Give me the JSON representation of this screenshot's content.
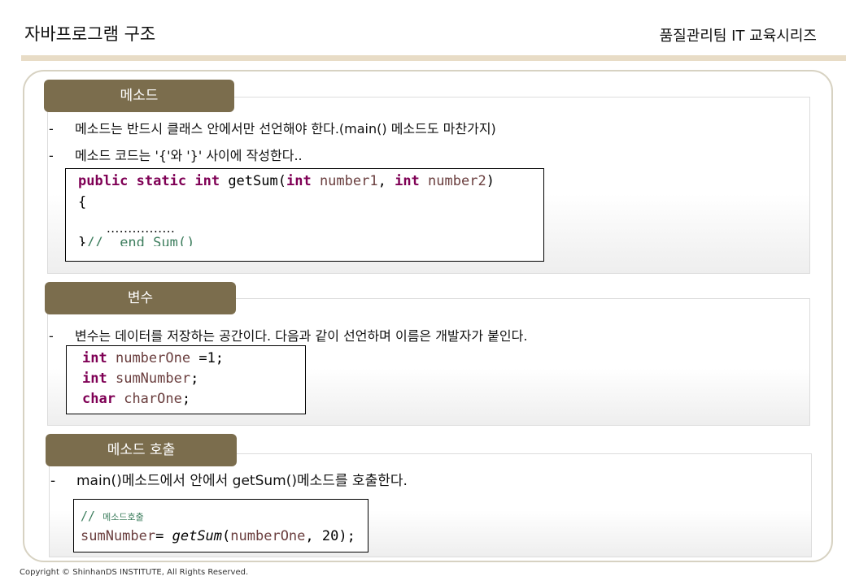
{
  "header": {
    "title": "자바프로그램 구조",
    "series": "품질관리팀 IT 교육시리즈"
  },
  "sections": [
    {
      "tab": "메소드",
      "bullets": [
        "메소드는 반드시 클래스 안에서만 선언해야 한다.(main() 메소드도 마찬가지)",
        "메소드 코드는 '{'와 '}' 사이에 작성한다.."
      ],
      "code": {
        "kw_public": "public",
        "kw_static": "static",
        "kw_int": "int",
        "method": "getSum(",
        "param_type1": "int",
        "param1": "number1",
        "comma": ", ",
        "param_type2": "int",
        "param2": "number2",
        "close_paren": ")",
        "open_brace": "{",
        "dots": "................",
        "close_brace": "}",
        "trailing_comment": "//  end Sum()"
      }
    },
    {
      "tab": "변수",
      "bullets": [
        "변수는 데이터를 저장하는 공간이다. 다음과 같이 선언하며 이름은 개발자가 붙인다."
      ],
      "code": {
        "line1_type": "int",
        "line1_name": "numberOne",
        "line1_rest": " =1;",
        "line2_type": "int",
        "line2_name": "sumNumber",
        "line2_rest": ";",
        "line3_type": "char",
        "line3_name": "charOne",
        "line3_rest": ";"
      }
    },
    {
      "tab": "메소드 호출",
      "bullets": [
        "main()메소드에서 안에서 getSum()메소드를 호출한다."
      ],
      "code": {
        "comment_slashes": "// ",
        "comment_text": "메소드호출",
        "var": "sumNumber",
        "assign": "= ",
        "call": "getSum",
        "args_open": "(",
        "arg1": "numberOne",
        "args_rest": ", 20);"
      }
    }
  ],
  "footer": "Copyright © ShinhanDS INSTITUTE, All Rights Reserved.",
  "colors": {
    "tab": "#7b6d4d",
    "rule": "#e8dcc6",
    "keyword": "#7f0055",
    "identifier": "#6a3e3e",
    "comment": "#3f7f5f"
  }
}
